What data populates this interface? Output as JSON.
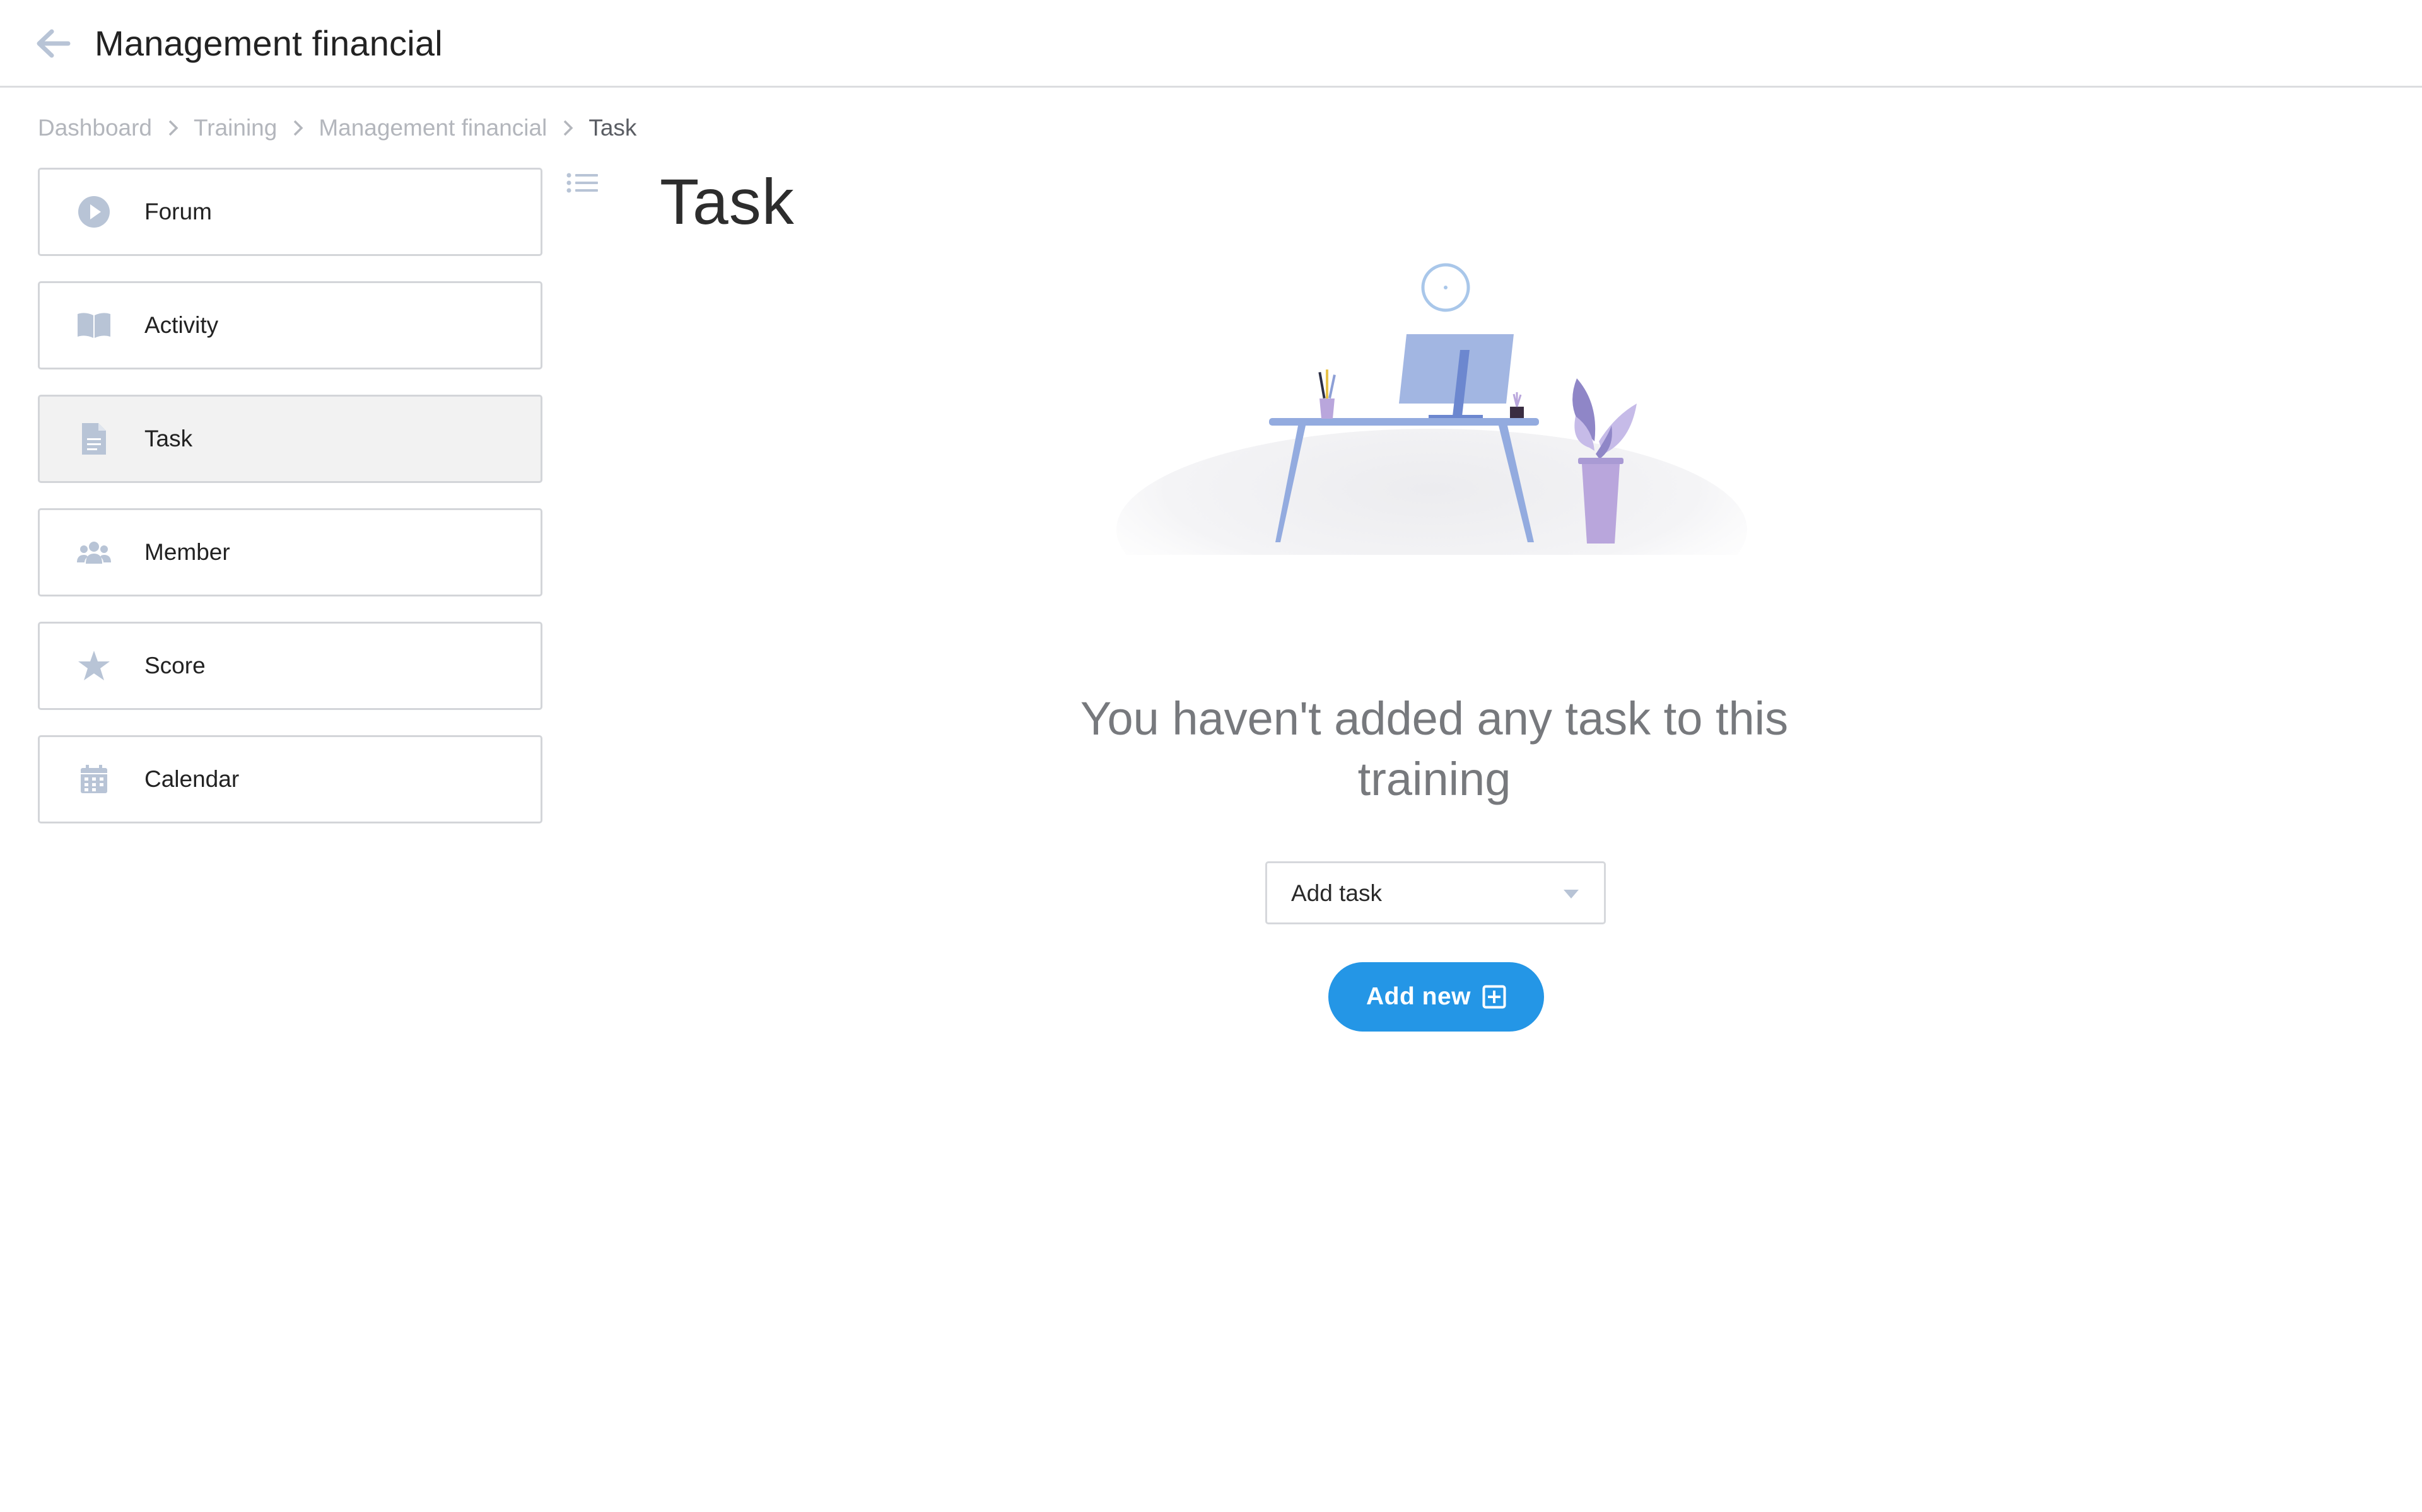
{
  "header": {
    "back_icon": "arrow-left-icon",
    "title": "Management financial"
  },
  "breadcrumb": {
    "items": [
      "Dashboard",
      "Training",
      "Management financial",
      "Task"
    ],
    "separator_icon": "chevron-right-icon"
  },
  "sidebar": {
    "items": [
      {
        "label": "Forum",
        "icon": "play-circle-icon",
        "active": false
      },
      {
        "label": "Activity",
        "icon": "book-open-icon",
        "active": false
      },
      {
        "label": "Task",
        "icon": "document-icon",
        "active": true
      },
      {
        "label": "Member",
        "icon": "users-icon",
        "active": false
      },
      {
        "label": "Score",
        "icon": "star-icon",
        "active": false
      },
      {
        "label": "Calendar",
        "icon": "calendar-icon",
        "active": false
      }
    ],
    "toggle_icon": "list-icon"
  },
  "main": {
    "title": "Task",
    "illustration": "empty-desk-illustration",
    "empty_message": "You haven't added any task to this training",
    "select": {
      "value": "Add task",
      "caret_icon": "caret-down-icon"
    },
    "add_button": {
      "label": "Add new",
      "icon": "plus-square-icon"
    }
  },
  "colors": {
    "accent": "#2496e6",
    "icon": "#b8c4d6",
    "border": "#d3d5d9",
    "active_bg": "#f2f2f2",
    "muted_text": "#b3b6bc"
  }
}
